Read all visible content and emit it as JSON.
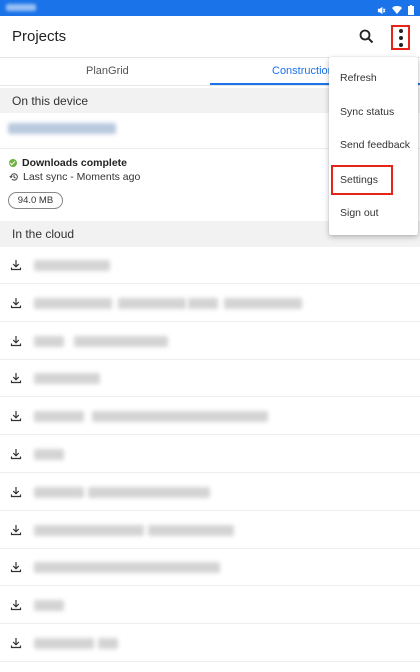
{
  "app_bar": {
    "title": "Projects",
    "search_icon": "search-icon",
    "menu_icon": "more-vertical-icon"
  },
  "tabs": [
    {
      "label": "PlanGrid",
      "active": false
    },
    {
      "label": "Construction",
      "active": true
    }
  ],
  "on_device": {
    "header": "On this device",
    "download_status": "Downloads complete",
    "last_sync": "Last sync - Moments ago",
    "size": "94.0 MB"
  },
  "in_cloud": {
    "header": "In the cloud",
    "row_icon": "download-icon"
  },
  "overflow_menu": {
    "items": [
      {
        "label": "Refresh"
      },
      {
        "label": "Sync status"
      },
      {
        "label": "Send feedback"
      },
      {
        "label": "Settings",
        "highlighted": true
      },
      {
        "label": "Sign out"
      }
    ]
  },
  "colors": {
    "accent": "#1a73e8",
    "highlight_border": "#e8231a",
    "success": "#6db33f"
  }
}
